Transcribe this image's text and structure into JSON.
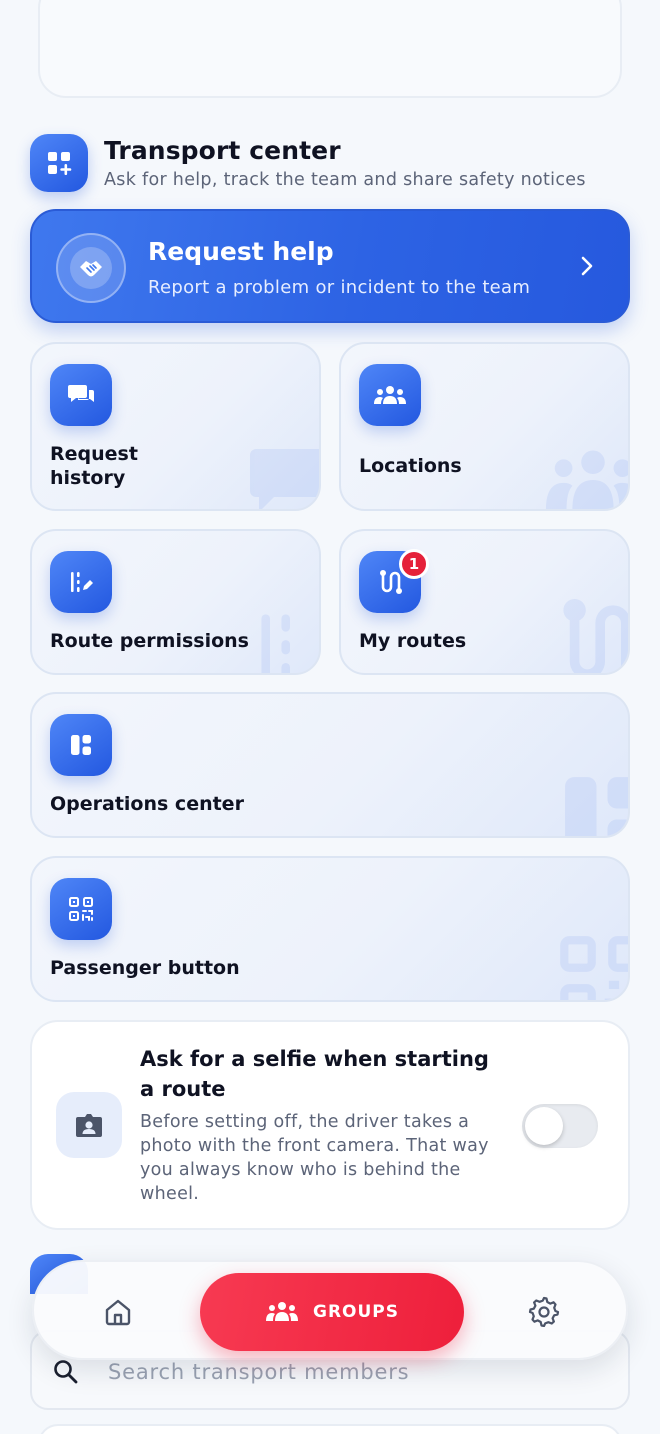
{
  "section": {
    "title": "Transport center",
    "subtitle": "Ask for help, track the team and share safety notices",
    "icon": "dashboard-plus-icon"
  },
  "help_card": {
    "title": "Request help",
    "subtitle": "Report a problem or incident to the team",
    "icon": "handshake-icon"
  },
  "tiles": [
    {
      "label": "Request history",
      "icon": "chat-bubbles-icon"
    },
    {
      "label": "Locations",
      "icon": "people-group-icon"
    },
    {
      "label": "Route permissions",
      "icon": "edit-list-icon"
    },
    {
      "label": "My routes",
      "icon": "route-icon",
      "badge": "1"
    },
    {
      "label": "Operations center",
      "icon": "panels-icon"
    },
    {
      "label": "Passenger button",
      "icon": "qr-code-icon"
    }
  ],
  "selfie": {
    "title": "Ask for a selfie when starting a route",
    "description": "Before setting off, the driver takes a photo with the front camera. That way you always know who is behind the wheel.",
    "toggle_on": false
  },
  "search": {
    "placeholder": "Search transport members"
  },
  "nav": {
    "groups_label": "GROUPS",
    "active": "groups"
  },
  "colors": {
    "primary": "#2d63e4",
    "accent": "#ee1f3b",
    "text": "#0f1222",
    "muted": "#5c6478"
  }
}
